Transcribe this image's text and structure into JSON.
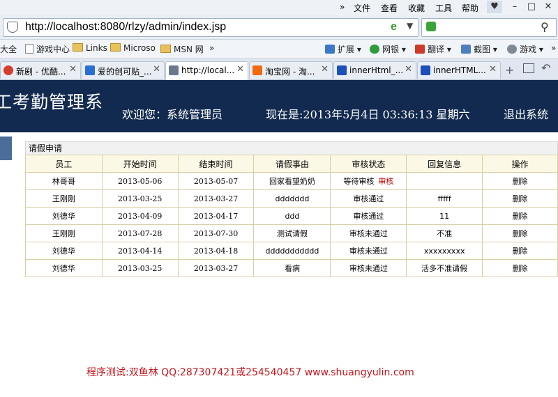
{
  "browser": {
    "menu": [
      "文件",
      "查看",
      "收藏",
      "工具",
      "帮助"
    ],
    "menu_more": "»",
    "address": "http://localhost:8080/rlzy/admin/index.jsp",
    "favorites": [
      "大全",
      "游戏中心",
      "Links",
      "Microso",
      "MSN 网"
    ],
    "favorites_more": "»",
    "tools": [
      "扩展",
      "网银",
      "翻译",
      "截图",
      "游戏"
    ],
    "tools_more": "»",
    "tabs": [
      {
        "label": "新剧 - 优酷...",
        "icon_color": "#d33f2c",
        "active": false
      },
      {
        "label": "爱的创可贴_...",
        "icon_color": "#2a6fd1",
        "active": false
      },
      {
        "label": "http://local...",
        "icon_color": "#6a7a8c",
        "active": true
      },
      {
        "label": "淘宝网 - 淘...",
        "icon_color": "#f26a10",
        "active": false
      },
      {
        "label": "innerHtml_...",
        "icon_color": "#1d4fb8",
        "active": false
      },
      {
        "label": "innerHTML...",
        "icon_color": "#1d4fb8",
        "active": false
      }
    ]
  },
  "header": {
    "title_partial": "工考勤管理系",
    "welcome": "欢迎您：系统管理员",
    "now": "现在是:2013年5月4日  03:36:13 星期六",
    "logout": "退出系统"
  },
  "panel": {
    "title": "请假申请",
    "columns": [
      "员工",
      "开始时间",
      "结束时间",
      "请假事由",
      "审核状态",
      "回复信息",
      "操作"
    ],
    "rows": [
      {
        "employee": "林哥哥",
        "start": "2013-05-06",
        "end": "2013-05-07",
        "reason": "回家看望奶奶",
        "status": "等待审核",
        "review_link": "审核",
        "reply": "",
        "action": "删除"
      },
      {
        "employee": "王刚刚",
        "start": "2013-03-25",
        "end": "2013-03-27",
        "reason": "ddddddd",
        "status": "审核通过",
        "review_link": "",
        "reply": "fffff",
        "action": "删除"
      },
      {
        "employee": "刘德华",
        "start": "2013-04-09",
        "end": "2013-04-17",
        "reason": "ddd",
        "status": "审核通过",
        "review_link": "",
        "reply": "11",
        "action": "删除"
      },
      {
        "employee": "王刚刚",
        "start": "2013-07-28",
        "end": "2013-07-30",
        "reason": "测试请假",
        "status": "审核未通过",
        "review_link": "",
        "reply": "不准",
        "action": "删除"
      },
      {
        "employee": "刘德华",
        "start": "2013-04-14",
        "end": "2013-04-18",
        "reason": "ddddddddddd",
        "status": "审核未通过",
        "review_link": "",
        "reply": "xxxxxxxxx",
        "action": "删除"
      },
      {
        "employee": "刘德华",
        "start": "2013-03-25",
        "end": "2013-03-27",
        "reason": "看病",
        "status": "审核未通过",
        "review_link": "",
        "reply": "活多不准请假",
        "action": "删除"
      }
    ]
  },
  "footer": "程序测试:双鱼林 QQ:287307421或254540457 www.shuangyulin.com"
}
